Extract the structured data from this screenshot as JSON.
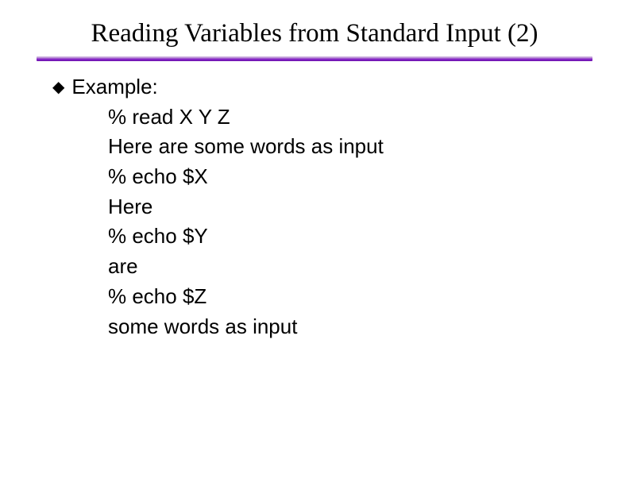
{
  "title": "Reading Variables from Standard Input (2)",
  "bullet_label": "Example:",
  "code_lines": [
    "% read X Y Z",
    "Here are some words as input",
    "% echo $X",
    "Here",
    "% echo $Y",
    "are",
    "% echo $Z",
    "some words as input"
  ]
}
